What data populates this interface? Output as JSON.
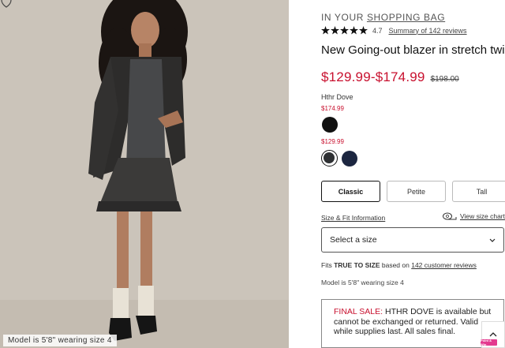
{
  "photo": {
    "caption": "Model is 5'8\" wearing size 4",
    "wishlist_icon": "heart-icon"
  },
  "bag": {
    "prefix": "IN YOUR",
    "link": "SHOPPING BAG"
  },
  "rating": {
    "stars": 5,
    "value": "4.7",
    "reviews_link": "Summary of 142 reviews"
  },
  "product": {
    "title": "New Going-out blazer in stretch twill",
    "price_range": "$129.99-$174.99",
    "original_price": "$198.00"
  },
  "colors": {
    "selected_name": "Hthr Dove",
    "group1_price": "$174.99",
    "group2_price": "$129.99",
    "swatches": [
      {
        "name": "black",
        "hex": "#111111"
      },
      {
        "name": "hthr-dove",
        "hex": "#2e3033",
        "selected": true
      },
      {
        "name": "navy",
        "hex": "#1c2640"
      }
    ]
  },
  "fit": {
    "tabs": [
      "Classic",
      "Petite",
      "Tall"
    ],
    "active": "Classic"
  },
  "size": {
    "fit_info_link": "Size & Fit Information",
    "chart_link": "View size chart",
    "placeholder": "Select a size"
  },
  "fits": {
    "prefix": "Fits",
    "true_to_size": "TRUE TO SIZE",
    "middle": "based on",
    "reviews_link": "142 customer reviews"
  },
  "model_info": "Model is 5'8\" wearing size 4",
  "final_sale": {
    "label": "FINAL SALE:",
    "text": "HTHR DOVE is available but cannot be exchanged or returned. Valid while supplies last. All sales final."
  },
  "badge": "Point & Win",
  "colors_theme": {
    "sale_red": "#c8102e",
    "photo_bg": "#cbc4ba"
  }
}
